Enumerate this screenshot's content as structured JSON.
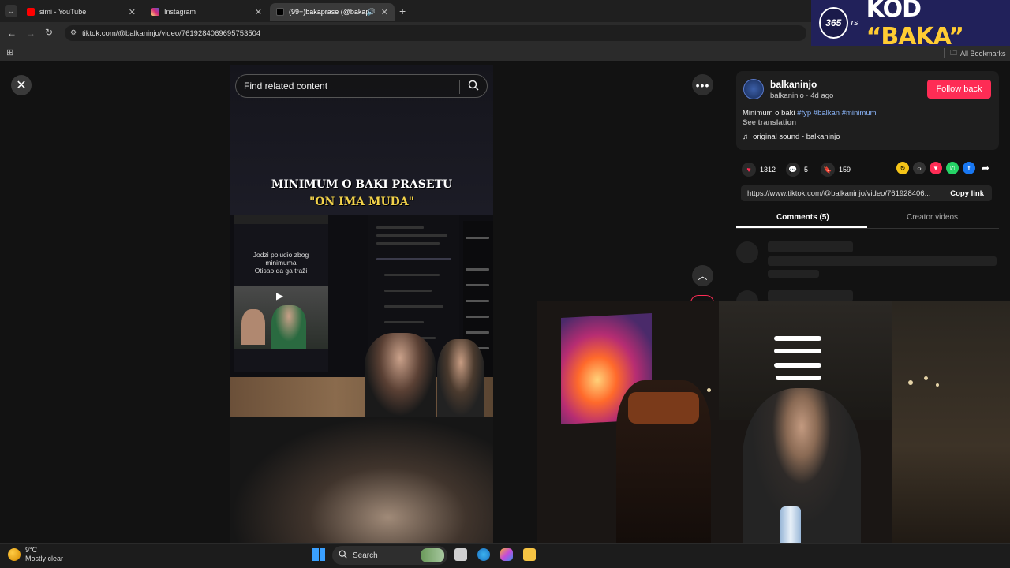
{
  "tabs": [
    {
      "label": "simi - YouTube",
      "color": "#ff0000"
    },
    {
      "label": "Instagram",
      "color": "#e1306c"
    },
    {
      "label": "(99+)bakaprase (@bakapra",
      "color": "#ffffff"
    }
  ],
  "new_tab_symbol": "+",
  "address": {
    "url": "tiktok.com/@balkaninjo/video/7619284069695753504"
  },
  "bookmarks": {
    "all_bookmarks": "All Bookmarks"
  },
  "promo": {
    "badge": "365",
    "suffix": "rs",
    "text_prefix": "KOD ",
    "text_open_quote": "“",
    "text_code": "BAKA",
    "text_close_quote": "”"
  },
  "video": {
    "search_placeholder": "Find related content",
    "caption_line1": "MINIMUM O BAKI PRASETU",
    "caption_line2": "\"ON IMA MUDA\"",
    "phone_text_line1": "Jodzi poludio zbog",
    "phone_text_line2": "minimuma",
    "phone_text_line3": "Otisao da ga traži"
  },
  "author": {
    "name": "balkaninjo",
    "handle": "balkaninjo",
    "separator": " · ",
    "time": "4d ago",
    "follow_label": "Follow back"
  },
  "description": {
    "text": "Minimum o baki ",
    "tags": [
      "#fyp",
      "#balkan",
      "#minimum"
    ],
    "see_translation": "See translation",
    "sound": "original sound - balkaninjo"
  },
  "stats": {
    "likes": "1312",
    "comments": "5",
    "saves": "159"
  },
  "share_link": {
    "url": "https://www.tiktok.com/@balkaninjo/video/761928406...",
    "copy_label": "Copy link"
  },
  "panel_tabs": {
    "comments": "Comments (5)",
    "creator_videos": "Creator videos"
  },
  "taskbar": {
    "temperature": "9°C",
    "condition": "Mostly clear",
    "search_label": "Search"
  },
  "colors": {
    "accent": "#fe2c55",
    "tag": "#8ab4f8"
  }
}
